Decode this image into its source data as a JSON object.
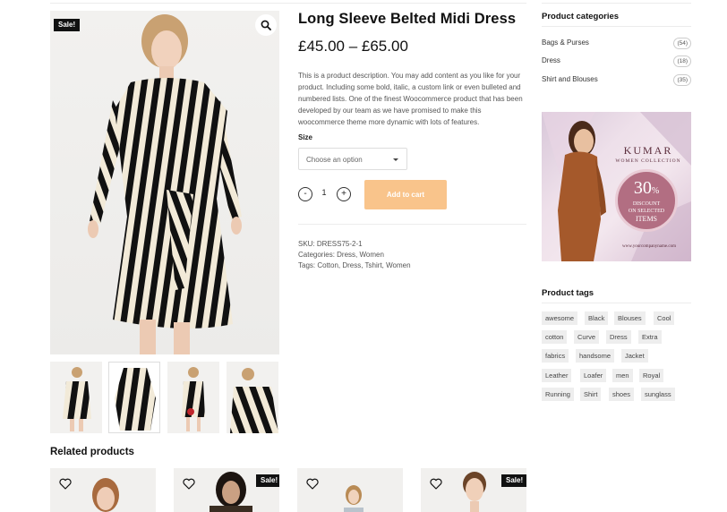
{
  "product": {
    "sale_badge": "Sale!",
    "title": "Long Sleeve Belted Midi Dress",
    "price": "£45.00 – £65.00",
    "description": "This is a product description. You may add content as you like for your product. Including some bold, italic, a custom link or even bulleted and numbered lists. One of the finest Woocommerce product that has been developed by our team as we have promised to make this woocommerce theme more dynamic with lots of features.",
    "size_label": "Size",
    "size_placeholder": "Choose an option",
    "qty_minus": "-",
    "qty_plus": "+",
    "quantity": "1",
    "add_to_cart": "Add to cart",
    "sku": "SKU: DRESS75-2-1",
    "categories": "Categories: Dress, Women",
    "tags": "Tags: Cotton, Dress, Tshirt, Women"
  },
  "sidebar": {
    "categories_title": "Product categories",
    "categories": [
      {
        "label": "Bags & Purses",
        "count": "(54)"
      },
      {
        "label": "Dress",
        "count": "(18)"
      },
      {
        "label": "Shirt and Blouses",
        "count": "(35)"
      }
    ],
    "banner": {
      "brand": "KUMAR",
      "collection": "WOMEN COLLECTION",
      "discount": "30",
      "percent": "%",
      "line1": "DISCOUNT",
      "line2": "ON SELECTED",
      "line3": "ITEMS",
      "url": "www.yourcompanyname.com"
    },
    "tags_title": "Product tags",
    "tags": [
      "awesome",
      "Black",
      "Blouses",
      "Cool",
      "cotton",
      "Curve",
      "Dress",
      "Extra",
      "fabrics",
      "handsome",
      "Jacket",
      "Leather",
      "Loafer",
      "men",
      "Royal",
      "Running",
      "Shirt",
      "shoes",
      "sunglass"
    ]
  },
  "related": {
    "title": "Related products",
    "sale_badge": "Sale!"
  },
  "colors": {
    "cart_button": "#f9c48b",
    "badge": "#111111",
    "banner_rose": "#b26e82"
  }
}
